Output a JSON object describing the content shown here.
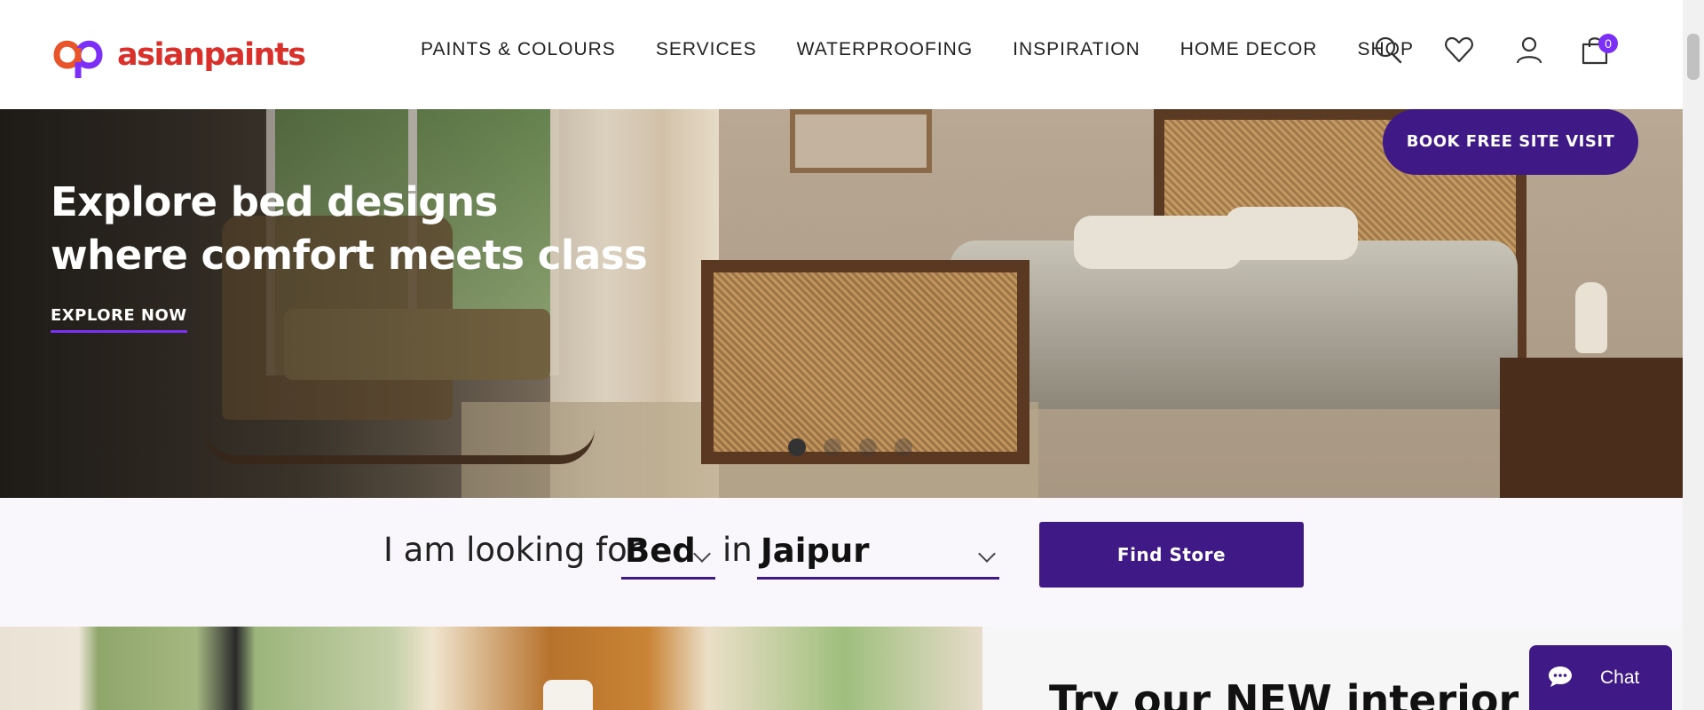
{
  "header": {
    "brand": "asianpaints",
    "nav": [
      "PAINTS & COLOURS",
      "SERVICES",
      "WATERPROOFING",
      "INSPIRATION",
      "HOME DECOR",
      "SHOP"
    ],
    "cart_count": "0",
    "icons": [
      "search-icon",
      "wishlist-heart-icon",
      "user-icon",
      "cart-icon"
    ]
  },
  "hero": {
    "title_line1": "Explore bed designs",
    "title_line2": "where comfort meets class",
    "cta": "EXPLORE NOW",
    "book_button": "BOOK FREE SITE VISIT",
    "slide_count": 4,
    "active_slide": 1
  },
  "finder": {
    "prefix": "I am looking for",
    "category": "Bed",
    "connector": "in",
    "city": "Jaipur",
    "button": "Find Store"
  },
  "lower": {
    "title": "Try our NEW interior desig"
  },
  "chat": {
    "label": "Chat"
  },
  "colors": {
    "brand_red": "#d9302b",
    "brand_purple": "#3f1a87",
    "badge_purple": "#7b2ff7"
  }
}
